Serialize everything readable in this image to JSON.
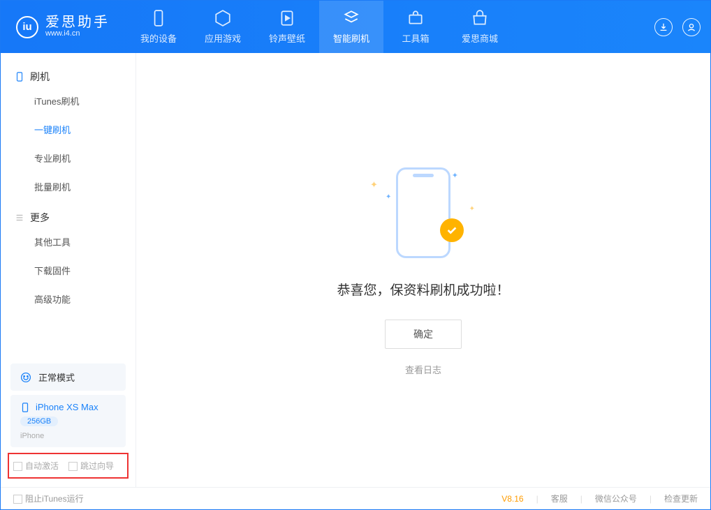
{
  "app": {
    "name": "爱思助手",
    "url": "www.i4.cn"
  },
  "tabs": [
    {
      "label": "我的设备"
    },
    {
      "label": "应用游戏"
    },
    {
      "label": "铃声壁纸"
    },
    {
      "label": "智能刷机"
    },
    {
      "label": "工具箱"
    },
    {
      "label": "爱思商城"
    }
  ],
  "sidebar": {
    "group1": {
      "title": "刷机",
      "items": [
        "iTunes刷机",
        "一键刷机",
        "专业刷机",
        "批量刷机"
      ]
    },
    "group2": {
      "title": "更多",
      "items": [
        "其他工具",
        "下载固件",
        "高级功能"
      ]
    }
  },
  "mode": {
    "label": "正常模式"
  },
  "device": {
    "name": "iPhone XS Max",
    "capacity": "256GB",
    "type": "iPhone"
  },
  "options": {
    "auto_activate": "自动激活",
    "skip_guide": "跳过向导"
  },
  "main": {
    "message": "恭喜您，保资料刷机成功啦！",
    "ok": "确定",
    "view_log": "查看日志"
  },
  "footer": {
    "block_itunes": "阻止iTunes运行",
    "version": "V8.16",
    "support": "客服",
    "wechat": "微信公众号",
    "check_update": "检查更新"
  }
}
